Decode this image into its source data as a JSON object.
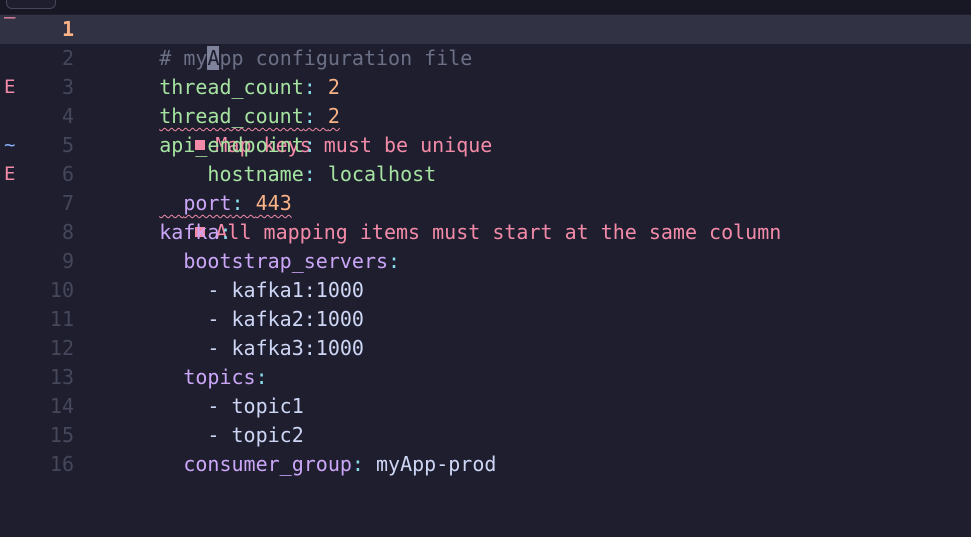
{
  "editor": {
    "gutter_signs": {
      "line1": "–",
      "line3": "E",
      "line5": "~",
      "line6": "E"
    },
    "lines": [
      {
        "n": "1",
        "parts": {
          "hash": "# ",
          "before": "my",
          "cursor": "A",
          "after": "pp configuration file"
        }
      },
      {
        "n": "2",
        "key": "thread_count",
        "sep": ": ",
        "value": "2"
      },
      {
        "n": "3",
        "key": "thread_count",
        "sep": ": ",
        "value": "2",
        "diagnostic": "Map keys must be unique"
      },
      {
        "n": "4",
        "key": "api_endpoint",
        "sep": ":"
      },
      {
        "n": "5",
        "indent": "    ",
        "key": "hostname",
        "sep": ": ",
        "value": "localhost"
      },
      {
        "n": "6",
        "indent": "  ",
        "key": "port",
        "sep": ": ",
        "value": "443",
        "diagnostic": "All mapping items must start at the same column"
      },
      {
        "n": "7",
        "key": "kafka",
        "sep": ":"
      },
      {
        "n": "8",
        "indent": "  ",
        "key": "bootstrap_servers",
        "sep": ":"
      },
      {
        "n": "9",
        "indent": "    ",
        "dash": "- ",
        "value": "kafka1:1000"
      },
      {
        "n": "10",
        "indent": "    ",
        "dash": "- ",
        "value": "kafka2:1000"
      },
      {
        "n": "11",
        "indent": "    ",
        "dash": "- ",
        "value": "kafka3:1000"
      },
      {
        "n": "12",
        "indent": "  ",
        "key": "topics",
        "sep": ":"
      },
      {
        "n": "13",
        "indent": "    ",
        "dash": "- ",
        "value": "topic1"
      },
      {
        "n": "14",
        "indent": "    ",
        "dash": "- ",
        "value": "topic2"
      },
      {
        "n": "15",
        "indent": "  ",
        "key": "consumer_group",
        "sep": ": ",
        "value": "myApp-prod"
      },
      {
        "n": "16"
      }
    ]
  },
  "colors": {
    "background": "#1e1e2e",
    "cursorline": "#313244",
    "error": "#f38ba8",
    "current_line_number": "#fab387"
  }
}
